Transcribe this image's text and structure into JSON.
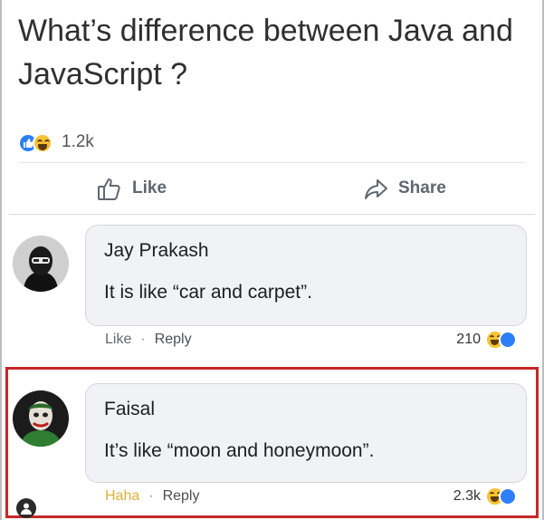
{
  "post": {
    "title": "What’s difference between Java and JavaScript ?",
    "reaction_count": "1.2k",
    "reaction_icons": [
      "like-icon",
      "haha-icon"
    ]
  },
  "actions": {
    "like_label": "Like",
    "share_label": "Share"
  },
  "comments": [
    {
      "author": "Jay Prakash",
      "text": "It is like “car and carpet”.",
      "like_label": "Like",
      "separator": "·",
      "reply_label": "Reply",
      "reaction_count": "210",
      "reaction_icons": [
        "haha-icon",
        "like-icon"
      ]
    },
    {
      "author": "Faisal",
      "text": "It’s like “moon and honeymoon”.",
      "like_label": "Haha",
      "separator": "·",
      "reply_label": "Reply",
      "reaction_count": "2.3k",
      "reaction_icons": [
        "haha-icon",
        "like-icon"
      ]
    }
  ],
  "colors": {
    "like_blue": "#2d7ff9",
    "haha_yellow": "#f7c235",
    "haha_label": "#d9b33b",
    "highlight_red": "#c62828",
    "bubble_bg": "#f0f2f5"
  }
}
